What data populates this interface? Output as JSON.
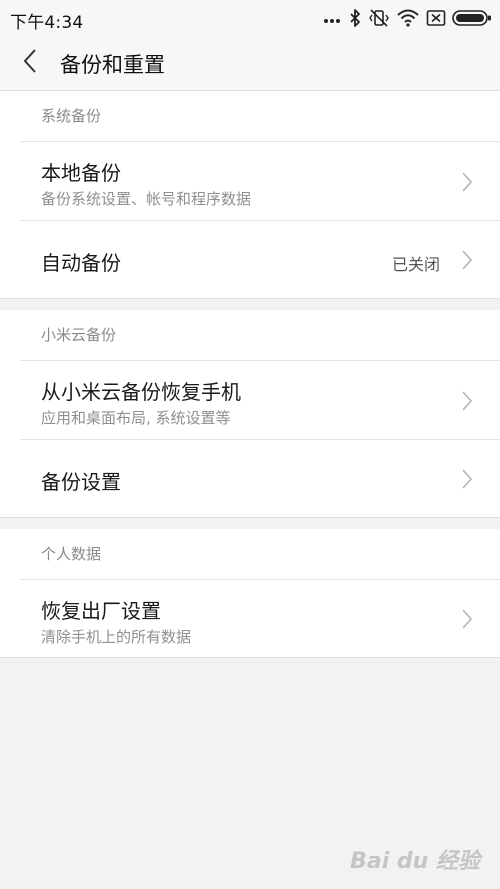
{
  "status_bar": {
    "time": "下午4:34",
    "icons": [
      "more-dots-icon",
      "bluetooth-icon",
      "vibrate-off-icon",
      "wifi-icon",
      "no-sim-icon",
      "battery-icon"
    ]
  },
  "header": {
    "back_icon": "back-chevron-icon",
    "title": "备份和重置"
  },
  "sections": [
    {
      "title": "系统备份",
      "items": [
        {
          "title": "本地备份",
          "subtitle": "备份系统设置、帐号和程序数据",
          "value": ""
        },
        {
          "title": "自动备份",
          "subtitle": "",
          "value": "已关闭"
        }
      ]
    },
    {
      "title": "小米云备份",
      "items": [
        {
          "title": "从小米云备份恢复手机",
          "subtitle": "应用和桌面布局, 系统设置等",
          "value": ""
        },
        {
          "title": "备份设置",
          "subtitle": "",
          "value": ""
        }
      ]
    },
    {
      "title": "个人数据",
      "items": [
        {
          "title": "恢复出厂设置",
          "subtitle": "清除手机上的所有数据",
          "value": ""
        }
      ]
    }
  ],
  "watermark": "Bai du 经验",
  "colors": {
    "background": "#f2f2f2",
    "card": "#ffffff",
    "section_title": "#8a8a8a",
    "subtitle": "#8f8f8f"
  }
}
